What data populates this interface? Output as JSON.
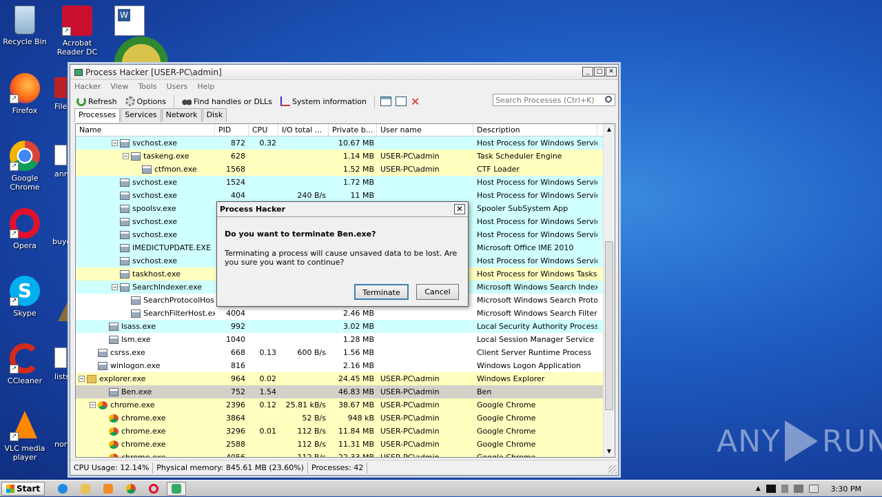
{
  "desktop": {
    "icons": [
      {
        "label": "Recycle Bin",
        "icon": "recycle-bin-icon"
      },
      {
        "label": "Acrobat Reader DC",
        "icon": "acrobat-icon"
      },
      {
        "label": "Firefox",
        "icon": "firefox-icon"
      },
      {
        "label": "Google Chrome",
        "icon": "chrome-icon"
      },
      {
        "label": "Opera",
        "icon": "opera-icon"
      },
      {
        "label": "Skype",
        "icon": "skype-icon"
      },
      {
        "label": "CCleaner",
        "icon": "ccleaner-icon"
      },
      {
        "label": "VLC media player",
        "icon": "vlc-icon"
      }
    ],
    "partial_labels": [
      "FileZ",
      "anno",
      "buye",
      "lists",
      "nort"
    ]
  },
  "window": {
    "title": "Process Hacker [USER-PC\\admin]",
    "menu": [
      "Hacker",
      "View",
      "Tools",
      "Users",
      "Help"
    ],
    "toolbar": {
      "refresh": "Refresh",
      "options": "Options",
      "find": "Find handles or DLLs",
      "sysinfo": "System information"
    },
    "search_placeholder": "Search Processes (Ctrl+K)",
    "tabs": [
      "Processes",
      "Services",
      "Network",
      "Disk"
    ],
    "columns": [
      "Name",
      "PID",
      "CPU",
      "I/O total ...",
      "Private b...",
      "User name",
      "Description"
    ],
    "rows": [
      {
        "indent": 3,
        "exp": "−",
        "name": "svchost.exe",
        "pid": "872",
        "cpu": "0.32",
        "io": "",
        "priv": "10.67 MB",
        "user": "",
        "desc": "Host Process for Windows Services",
        "bg": "#d0ffff",
        "icon": "svc"
      },
      {
        "indent": 4,
        "exp": "−",
        "name": "taskeng.exe",
        "pid": "628",
        "cpu": "",
        "io": "",
        "priv": "1.14 MB",
        "user": "USER-PC\\admin",
        "desc": "Task Scheduler Engine",
        "bg": "#ffffc0",
        "icon": "svc"
      },
      {
        "indent": 5,
        "exp": "",
        "name": "ctfmon.exe",
        "pid": "1568",
        "cpu": "",
        "io": "",
        "priv": "1.52 MB",
        "user": "USER-PC\\admin",
        "desc": "CTF Loader",
        "bg": "#ffffc0",
        "icon": "svc"
      },
      {
        "indent": 3,
        "exp": "",
        "name": "svchost.exe",
        "pid": "1524",
        "cpu": "",
        "io": "",
        "priv": "1.72 MB",
        "user": "",
        "desc": "Host Process for Windows Services",
        "bg": "#d0ffff",
        "icon": "svc"
      },
      {
        "indent": 3,
        "exp": "",
        "name": "svchost.exe",
        "pid": "404",
        "cpu": "",
        "io": "240 B/s",
        "priv": "11 MB",
        "user": "",
        "desc": "Host Process for Windows Services",
        "bg": "#d0ffff",
        "icon": "svc"
      },
      {
        "indent": 3,
        "exp": "",
        "name": "spoolsv.exe",
        "pid": "",
        "cpu": "",
        "io": "",
        "priv": "",
        "user": "",
        "desc": "Spooler SubSystem App",
        "bg": "#d0ffff",
        "icon": "svc"
      },
      {
        "indent": 3,
        "exp": "",
        "name": "svchost.exe",
        "pid": "",
        "cpu": "",
        "io": "",
        "priv": "",
        "user": "",
        "desc": "Host Process for Windows Services",
        "bg": "#d0ffff",
        "icon": "svc"
      },
      {
        "indent": 3,
        "exp": "",
        "name": "svchost.exe",
        "pid": "",
        "cpu": "",
        "io": "",
        "priv": "",
        "user": "",
        "desc": "Host Process for Windows Services",
        "bg": "#d0ffff",
        "icon": "svc"
      },
      {
        "indent": 3,
        "exp": "",
        "name": "IMEDICTUPDATE.EXE",
        "pid": "",
        "cpu": "",
        "io": "",
        "priv": "",
        "user": "",
        "desc": "Microsoft Office IME 2010",
        "bg": "#d0ffff",
        "icon": "svc"
      },
      {
        "indent": 3,
        "exp": "",
        "name": "svchost.exe",
        "pid": "",
        "cpu": "",
        "io": "",
        "priv": "",
        "user": "",
        "desc": "Host Process for Windows Services",
        "bg": "#d0ffff",
        "icon": "svc"
      },
      {
        "indent": 3,
        "exp": "",
        "name": "taskhost.exe",
        "pid": "",
        "cpu": "",
        "io": "",
        "priv": "",
        "user": "",
        "desc": "Host Process for Windows Tasks",
        "bg": "#ffffc0",
        "icon": "svc"
      },
      {
        "indent": 3,
        "exp": "−",
        "name": "SearchIndexer.exe",
        "pid": "",
        "cpu": "",
        "io": "",
        "priv": "",
        "user": "",
        "desc": "Microsoft Windows Search Indexer",
        "bg": "#d0ffff",
        "icon": "svc"
      },
      {
        "indent": 4,
        "exp": "",
        "name": "SearchProtocolHos...",
        "pid": "",
        "cpu": "",
        "io": "",
        "priv": "",
        "user": "",
        "desc": "Microsoft Windows Search Proto...",
        "bg": "#ffffff",
        "icon": "svc"
      },
      {
        "indent": 4,
        "exp": "",
        "name": "SearchFilterHost.exe",
        "pid": "4004",
        "cpu": "",
        "io": "",
        "priv": "2.46 MB",
        "user": "",
        "desc": "Microsoft Windows Search Filter ...",
        "bg": "#ffffff",
        "icon": "svc"
      },
      {
        "indent": 2,
        "exp": "",
        "name": "lsass.exe",
        "pid": "992",
        "cpu": "",
        "io": "",
        "priv": "3.02 MB",
        "user": "",
        "desc": "Local Security Authority Process",
        "bg": "#d0ffff",
        "icon": "svc"
      },
      {
        "indent": 2,
        "exp": "",
        "name": "lsm.exe",
        "pid": "1040",
        "cpu": "",
        "io": "",
        "priv": "1.28 MB",
        "user": "",
        "desc": "Local Session Manager Service",
        "bg": "#ffffff",
        "icon": "svc"
      },
      {
        "indent": 1,
        "exp": "",
        "name": "csrss.exe",
        "pid": "668",
        "cpu": "0.13",
        "io": "600 B/s",
        "priv": "1.56 MB",
        "user": "",
        "desc": "Client Server Runtime Process",
        "bg": "#ffffff",
        "icon": "svc"
      },
      {
        "indent": 1,
        "exp": "",
        "name": "winlogon.exe",
        "pid": "816",
        "cpu": "",
        "io": "",
        "priv": "2.16 MB",
        "user": "",
        "desc": "Windows Logon Application",
        "bg": "#ffffff",
        "icon": "svc"
      },
      {
        "indent": 0,
        "exp": "−",
        "name": "explorer.exe",
        "pid": "964",
        "cpu": "0.02",
        "io": "",
        "priv": "24.45 MB",
        "user": "USER-PC\\admin",
        "desc": "Windows Explorer",
        "bg": "#ffffc0",
        "icon": "folder"
      },
      {
        "indent": 2,
        "exp": "",
        "name": "Ben.exe",
        "pid": "752",
        "cpu": "1.54",
        "io": "",
        "priv": "46.83 MB",
        "user": "USER-PC\\admin",
        "desc": "Ben",
        "bg": "#d4d0c8",
        "icon": "svc"
      },
      {
        "indent": 1,
        "exp": "−",
        "name": "chrome.exe",
        "pid": "2396",
        "cpu": "0.12",
        "io": "25.81 kB/s",
        "priv": "38.67 MB",
        "user": "USER-PC\\admin",
        "desc": "Google Chrome",
        "bg": "#ffffc0",
        "icon": "chrome"
      },
      {
        "indent": 2,
        "exp": "",
        "name": "chrome.exe",
        "pid": "3864",
        "cpu": "",
        "io": "52 B/s",
        "priv": "948 kB",
        "user": "USER-PC\\admin",
        "desc": "Google Chrome",
        "bg": "#ffffc0",
        "icon": "chrome"
      },
      {
        "indent": 2,
        "exp": "",
        "name": "chrome.exe",
        "pid": "3296",
        "cpu": "0.01",
        "io": "112 B/s",
        "priv": "11.84 MB",
        "user": "USER-PC\\admin",
        "desc": "Google Chrome",
        "bg": "#ffffc0",
        "icon": "chrome"
      },
      {
        "indent": 2,
        "exp": "",
        "name": "chrome.exe",
        "pid": "2588",
        "cpu": "",
        "io": "112 B/s",
        "priv": "11.31 MB",
        "user": "USER-PC\\admin",
        "desc": "Google Chrome",
        "bg": "#ffffc0",
        "icon": "chrome"
      },
      {
        "indent": 2,
        "exp": "",
        "name": "chrome.exe",
        "pid": "4056",
        "cpu": "",
        "io": "112 B/s",
        "priv": "22.33 MB",
        "user": "USER-PC\\admin",
        "desc": "Google Chrome",
        "bg": "#ffffc0",
        "icon": "chrome"
      }
    ],
    "status": {
      "cpu": "CPU Usage: 12.14%",
      "mem": "Physical memory: 845.61 MB (23.60%)",
      "procs": "Processes: 42"
    }
  },
  "dialog": {
    "title": "Process Hacker",
    "question": "Do you want to terminate Ben.exe?",
    "message": "Terminating a process will cause unsaved data to be lost. Are you sure you want to continue?",
    "ok": "Terminate",
    "cancel": "Cancel"
  },
  "taskbar": {
    "start": "Start",
    "clock": "3:30 PM"
  },
  "watermark": {
    "left": "ANY",
    "right": "RUN"
  }
}
